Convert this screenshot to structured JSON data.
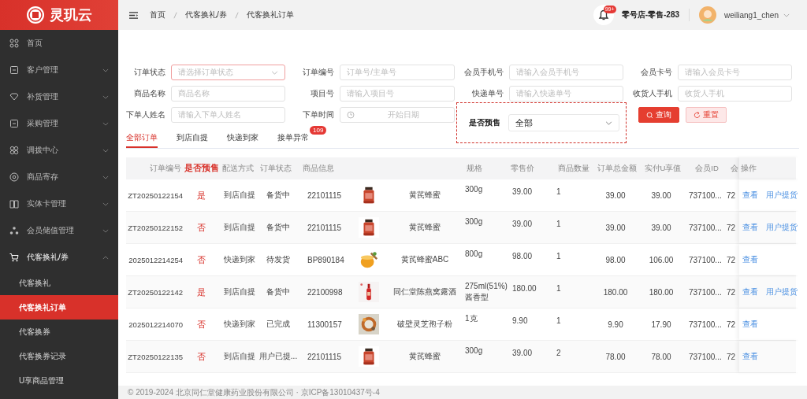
{
  "sidebar": {
    "logo": "灵玑云",
    "items": [
      {
        "label": "首页",
        "kind": "link",
        "expanded": false
      },
      {
        "label": "客户管理",
        "kind": "group",
        "expanded": false
      },
      {
        "label": "补货管理",
        "kind": "group",
        "expanded": false
      },
      {
        "label": "采购管理",
        "kind": "group",
        "expanded": false
      },
      {
        "label": "调拨中心",
        "kind": "group",
        "expanded": false
      },
      {
        "label": "商品寄存",
        "kind": "group",
        "expanded": false
      },
      {
        "label": "实体卡管理",
        "kind": "group",
        "expanded": false
      },
      {
        "label": "会员储值管理",
        "kind": "group",
        "expanded": false
      },
      {
        "label": "代客换礼/券",
        "kind": "group",
        "expanded": true,
        "children": [
          {
            "label": "代客换礼",
            "selected": false
          },
          {
            "label": "代客换礼订单",
            "selected": true
          },
          {
            "label": "代客换券",
            "selected": false
          },
          {
            "label": "代客换券记录",
            "selected": false
          },
          {
            "label": "U享商品管理",
            "selected": false
          }
        ]
      }
    ]
  },
  "header": {
    "breadcrumb": [
      "首页",
      "代客换礼/券",
      "代客换礼订单"
    ],
    "notification_badge": "99+",
    "store": "零号店-零售-283",
    "user": "weiliang1_chen"
  },
  "filters": [
    {
      "label": "订单状态",
      "kind": "select",
      "placeholder": "请选择订单状态",
      "focused": true
    },
    {
      "label": "订单编号",
      "kind": "input",
      "placeholder": "订单号/主单号",
      "focused": false
    },
    {
      "label": "会员手机号",
      "kind": "input",
      "placeholder": "请输入会员手机号",
      "focused": false
    },
    {
      "label": "会员卡号",
      "kind": "input",
      "placeholder": "请输入会员卡号",
      "focused": false
    },
    {
      "label": "商品名称",
      "kind": "input",
      "placeholder": "商品名称",
      "focused": false
    },
    {
      "label": "项目号",
      "kind": "input",
      "placeholder": "请输入项目号",
      "focused": false
    },
    {
      "label": "快递单号",
      "kind": "input",
      "placeholder": "请输入快递单号",
      "focused": false
    },
    {
      "label": "收货人手机",
      "kind": "input",
      "placeholder": "收货人手机",
      "focused": false
    },
    {
      "label": "下单人姓名",
      "kind": "input",
      "placeholder": "请输入下单人姓名",
      "focused": false
    },
    {
      "label": "下单时间",
      "kind": "date",
      "placeholder": "开始日期",
      "focused": false
    }
  ],
  "presale_filter": {
    "label": "是否预售",
    "value": "全部"
  },
  "buttons": [
    {
      "label": "查询",
      "kind": "primary"
    },
    {
      "label": "重置",
      "kind": "secondary"
    }
  ],
  "tabs": [
    {
      "label": "全部订单",
      "selected": true
    },
    {
      "label": "到店自提",
      "selected": false
    },
    {
      "label": "快递到家",
      "selected": false
    },
    {
      "label": "接单异常",
      "selected": false,
      "badge": "109"
    }
  ],
  "table": {
    "columns": [
      "订单编号",
      "是否预售",
      "配送方式",
      "订单状态",
      "商品信息",
      "规格",
      "零售价",
      "商品数量",
      "订单总金额",
      "实付U享值",
      "会员ID",
      "会",
      "操作"
    ],
    "rows": [
      {
        "order_no": "ZT20250122154",
        "presale": "是",
        "delivery": "到店自提",
        "status": "备货中",
        "product_code": "22101115",
        "product_name": "黄芪蜂蜜",
        "spec": "300g",
        "price": "39.00",
        "quantity": "1",
        "total": "39.00",
        "paid": "39.00",
        "member_id": "737100...",
        "column_12": "72",
        "actions": [
          "查看",
          "用户提货"
        ]
      },
      {
        "order_no": "ZT20250122152",
        "presale": "否",
        "delivery": "到店自提",
        "status": "备货中",
        "product_code": "22101115",
        "product_name": "黄芪蜂蜜",
        "spec": "300g",
        "price": "39.00",
        "quantity": "1",
        "total": "39.00",
        "paid": "39.00",
        "member_id": "737100...",
        "column_12": "72",
        "actions": [
          "查看",
          "用户提货"
        ]
      },
      {
        "order_no": "2025012214254",
        "presale": "否",
        "delivery": "快递到家",
        "status": "待发货",
        "product_code": "BP890184",
        "product_name": "黄芪蜂蜜ABC",
        "spec": "800g",
        "price": "98.00",
        "quantity": "1",
        "total": "98.00",
        "paid": "106.00",
        "member_id": "737100...",
        "column_12": "72",
        "actions": [
          "查看"
        ]
      },
      {
        "order_no": "ZT20250122142",
        "presale": "是",
        "delivery": "到店自提",
        "status": "备货中",
        "product_code": "22100998",
        "product_name": "同仁堂陈燕窝露酒",
        "spec": "275ml(51%)酱香型",
        "price": "180.00",
        "quantity": "1",
        "total": "180.00",
        "paid": "180.00",
        "member_id": "737100...",
        "column_12": "72",
        "actions": [
          "查看",
          "用户提货"
        ]
      },
      {
        "order_no": "2025012214070",
        "presale": "否",
        "delivery": "快递到家",
        "status": "已完成",
        "product_code": "11300157",
        "product_name": "破壁灵芝孢子粉",
        "spec": "1克",
        "price": "9.90",
        "quantity": "1",
        "total": "9.90",
        "paid": "17.90",
        "member_id": "737100...",
        "column_12": "72",
        "actions": [
          "查看"
        ]
      },
      {
        "order_no": "ZT20250122135",
        "presale": "否",
        "delivery": "到店自提",
        "status": "用户已提...",
        "product_code": "22101115",
        "product_name": "黄芪蜂蜜",
        "spec": "300g",
        "price": "39.00",
        "quantity": "2",
        "total": "78.00",
        "paid": "78.00",
        "member_id": "737100...",
        "column_12": "72",
        "actions": [
          "查看"
        ]
      }
    ]
  },
  "footer": "© 2019-2024 北京同仁堂健康药业股份有限公司 · 京ICP备13010437号-4"
}
